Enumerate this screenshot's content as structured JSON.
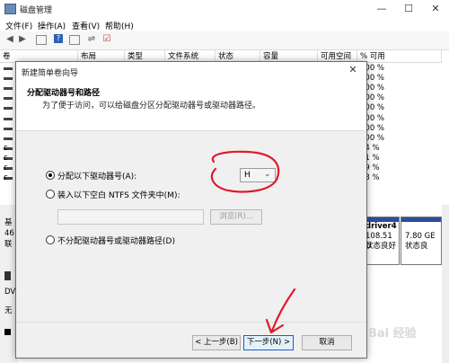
{
  "window": {
    "title": "磁盘管理",
    "min_glyph": "—",
    "max_glyph": "☐",
    "close_glyph": "✕"
  },
  "menu": [
    "文件(F)",
    "操作(A)",
    "查看(V)",
    "帮助(H)"
  ],
  "toolbar_icons": [
    "back-arrow-icon",
    "forward-arrow-icon",
    "grid-icon",
    "help-icon",
    "properties-icon",
    "connect-icon",
    "refresh-icon"
  ],
  "columns": [
    "卷",
    "布局",
    "类型",
    "文件系统",
    "状态",
    "容量",
    "可用空间",
    "% 可用"
  ],
  "pct_values": [
    "100 %",
    "100 %",
    "100 %",
    "100 %",
    "100 %",
    "100 %",
    "100 %",
    "100 %",
    "54 %",
    "81 %",
    "29 %",
    "48 %"
  ],
  "row_prefix": [
    "",
    "",
    "",
    "",
    "",
    "",
    "",
    "",
    "c",
    "c",
    "c",
    "c"
  ],
  "lower": {
    "left_fragments": [
      "基",
      "46",
      "联",
      "DV",
      "无"
    ],
    "driver_label": "driver4",
    "driver_size": "108.51 G",
    "driver_status": "状态良好",
    "next_size": "7.80 GE",
    "next_status": "状态良"
  },
  "dialog": {
    "title": "新建简单卷向导",
    "close_glyph": "✕",
    "header_title": "分配驱动器号和路径",
    "header_sub": "为了便于访问，可以给磁盘分区分配驱动器号或驱动器路径。",
    "option_assign": "分配以下驱动器号(A):",
    "drive_letter": "H",
    "option_mount": "装入以下空白 NTFS 文件夹中(M):",
    "path_value": "",
    "browse_label": "浏览(R)...",
    "option_none": "不分配驱动器号或驱动器路径(D)",
    "back_label": "< 上一步(B)",
    "next_label": "下一步(N) >",
    "cancel_label": "取消",
    "selected_option": "assign"
  },
  "watermark": "Bai 经验",
  "colors": {
    "annotation": "#e0192b",
    "accent": "#0a64c8",
    "volume_bar": "#2b4e9a"
  }
}
